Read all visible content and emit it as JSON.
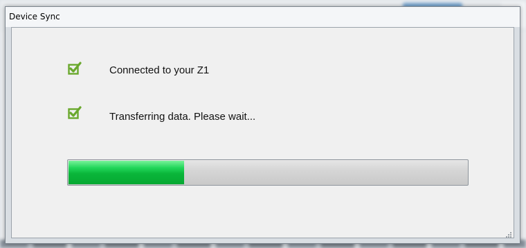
{
  "dialog": {
    "title": "Device Sync"
  },
  "steps": [
    {
      "label": "Connected to your Z1",
      "icon": "checkbox-checked-icon",
      "checked": true
    },
    {
      "label": "Transferring data. Please wait...",
      "icon": "checkbox-checked-icon",
      "checked": true
    }
  ],
  "progress": {
    "fraction": 0.29
  },
  "colors": {
    "check": "#6aa82d",
    "progress_fill": "#0ab63a"
  }
}
